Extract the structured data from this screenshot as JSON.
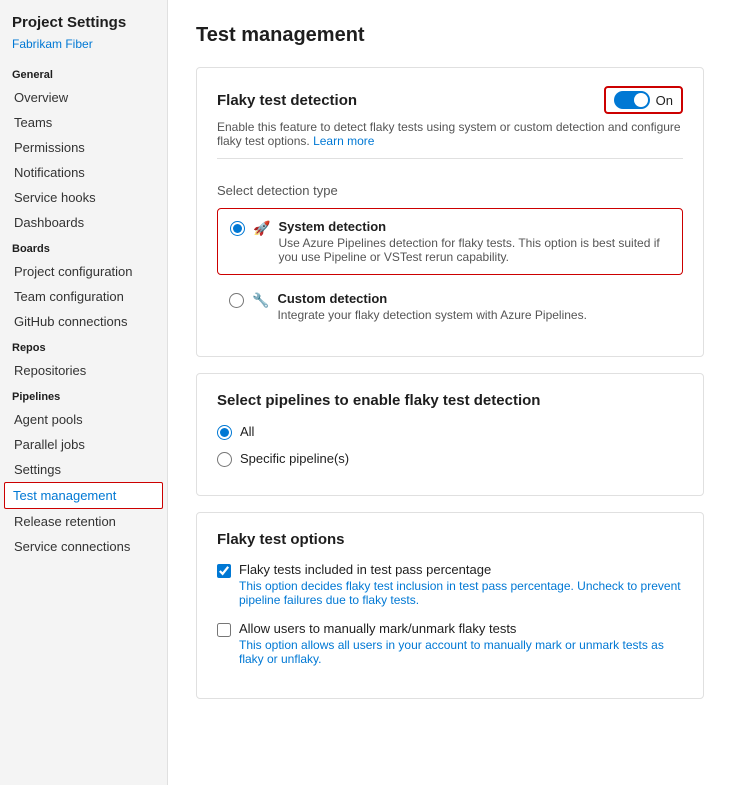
{
  "sidebar": {
    "title": "Project Settings",
    "subtitle": "Fabrikam Fiber",
    "sections": [
      {
        "header": "General",
        "items": [
          {
            "id": "overview",
            "label": "Overview",
            "active": false
          },
          {
            "id": "teams",
            "label": "Teams",
            "active": false
          },
          {
            "id": "permissions",
            "label": "Permissions",
            "active": false
          },
          {
            "id": "notifications",
            "label": "Notifications",
            "active": false
          },
          {
            "id": "service-hooks",
            "label": "Service hooks",
            "active": false
          },
          {
            "id": "dashboards",
            "label": "Dashboards",
            "active": false
          }
        ]
      },
      {
        "header": "Boards",
        "items": [
          {
            "id": "project-configuration",
            "label": "Project configuration",
            "active": false
          },
          {
            "id": "team-configuration",
            "label": "Team configuration",
            "active": false
          },
          {
            "id": "github-connections",
            "label": "GitHub connections",
            "active": false
          }
        ]
      },
      {
        "header": "Repos",
        "items": [
          {
            "id": "repositories",
            "label": "Repositories",
            "active": false
          }
        ]
      },
      {
        "header": "Pipelines",
        "items": [
          {
            "id": "agent-pools",
            "label": "Agent pools",
            "active": false
          },
          {
            "id": "parallel-jobs",
            "label": "Parallel jobs",
            "active": false
          },
          {
            "id": "settings",
            "label": "Settings",
            "active": false
          },
          {
            "id": "test-management",
            "label": "Test management",
            "active": true
          },
          {
            "id": "release-retention",
            "label": "Release retention",
            "active": false
          },
          {
            "id": "service-connections",
            "label": "Service connections",
            "active": false
          }
        ]
      }
    ]
  },
  "main": {
    "page_title": "Test management",
    "flaky_card": {
      "title": "Flaky test detection",
      "toggle_label": "On",
      "description": "Enable this feature to detect flaky tests using system or custom detection and configure flaky test options.",
      "learn_more": "Learn more",
      "detection_section_label": "Select detection type",
      "detection_options": [
        {
          "id": "system",
          "title": "System detection",
          "description": "Use Azure Pipelines detection for flaky tests. This option is best suited if you use Pipeline or VSTest rerun capability.",
          "selected": true,
          "icon": "🚀"
        },
        {
          "id": "custom",
          "title": "Custom detection",
          "description": "Integrate your flaky detection system with Azure Pipelines.",
          "selected": false,
          "icon": "🔧"
        }
      ]
    },
    "pipelines_card": {
      "title": "Select pipelines to enable flaky test detection",
      "options": [
        {
          "id": "all",
          "label": "All",
          "selected": true
        },
        {
          "id": "specific",
          "label": "Specific pipeline(s)",
          "selected": false
        }
      ]
    },
    "options_card": {
      "title": "Flaky test options",
      "checkboxes": [
        {
          "id": "include-pass",
          "label": "Flaky tests included in test pass percentage",
          "description": "This option decides flaky test inclusion in test pass percentage. Uncheck to prevent pipeline failures due to flaky tests.",
          "checked": true
        },
        {
          "id": "manual-mark",
          "label": "Allow users to manually mark/unmark flaky tests",
          "description": "This option allows all users in your account to manually mark or unmark tests as flaky or unflaky.",
          "checked": false
        }
      ]
    }
  }
}
